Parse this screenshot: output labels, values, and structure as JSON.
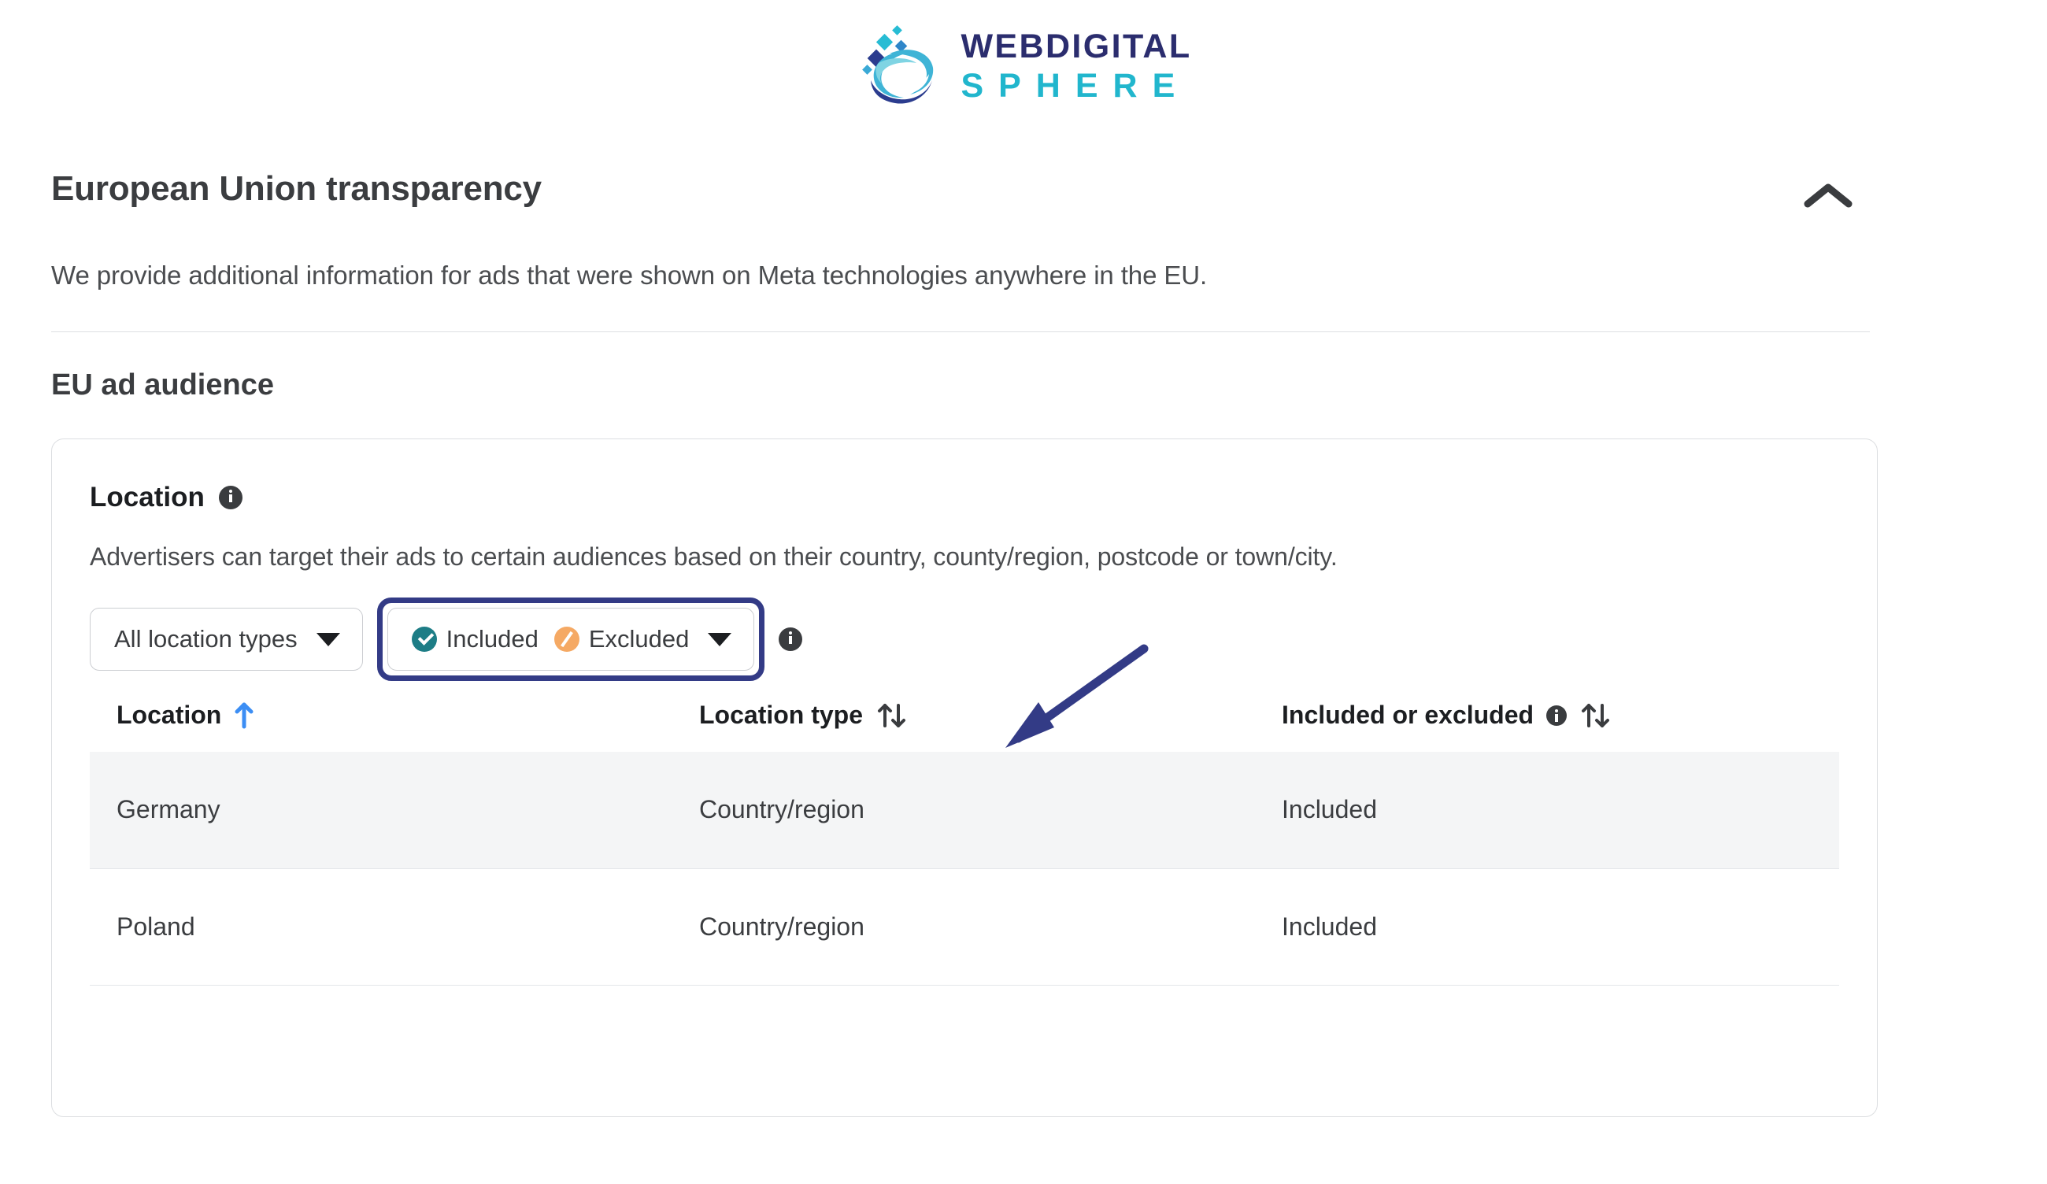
{
  "brand": {
    "name_top": "WEBDIGITAL",
    "name_bottom": "SPHERE",
    "logo_icon": "globe-swoosh-logo",
    "color_top": "#2b2d6e",
    "color_bottom": "#21b6cd"
  },
  "section": {
    "title": "European Union transparency",
    "collapse_icon": "chevron-up-icon",
    "description": "We provide additional information for ads that were shown on Meta technologies anywhere in the EU."
  },
  "subsection": {
    "title": "EU ad audience"
  },
  "card": {
    "title": "Location",
    "title_info_icon": "info-icon",
    "description": "Advertisers can target their ads to certain audiences based on their country, county/region, postcode or town/city.",
    "filters": {
      "location_type": {
        "label": "All location types",
        "caret_icon": "chevron-down-icon"
      },
      "inclusion": {
        "included_label": "Included",
        "excluded_label": "Excluded",
        "included_icon": "check-circle-icon",
        "excluded_icon": "slash-circle-icon",
        "included_color": "#1d7d86",
        "excluded_color": "#f5a964",
        "caret_icon": "chevron-down-icon",
        "highlight_color": "#333b86"
      },
      "inclusion_info_icon": "info-icon"
    },
    "table": {
      "columns": [
        {
          "label": "Location",
          "sort_icon": "sort-ascending-icon",
          "sort_active": true
        },
        {
          "label": "Location type",
          "sort_icon": "sort-both-icon",
          "sort_active": false
        },
        {
          "label": "Included or excluded",
          "info_icon": "info-icon",
          "sort_icon": "sort-both-icon",
          "sort_active": false
        }
      ],
      "rows": [
        {
          "location": "Germany",
          "location_type": "Country/region",
          "status": "Included"
        },
        {
          "location": "Poland",
          "location_type": "Country/region",
          "status": "Included"
        }
      ]
    }
  },
  "annotation": {
    "arrow_icon": "arrow-pointing-down-left",
    "color": "#333b86"
  }
}
